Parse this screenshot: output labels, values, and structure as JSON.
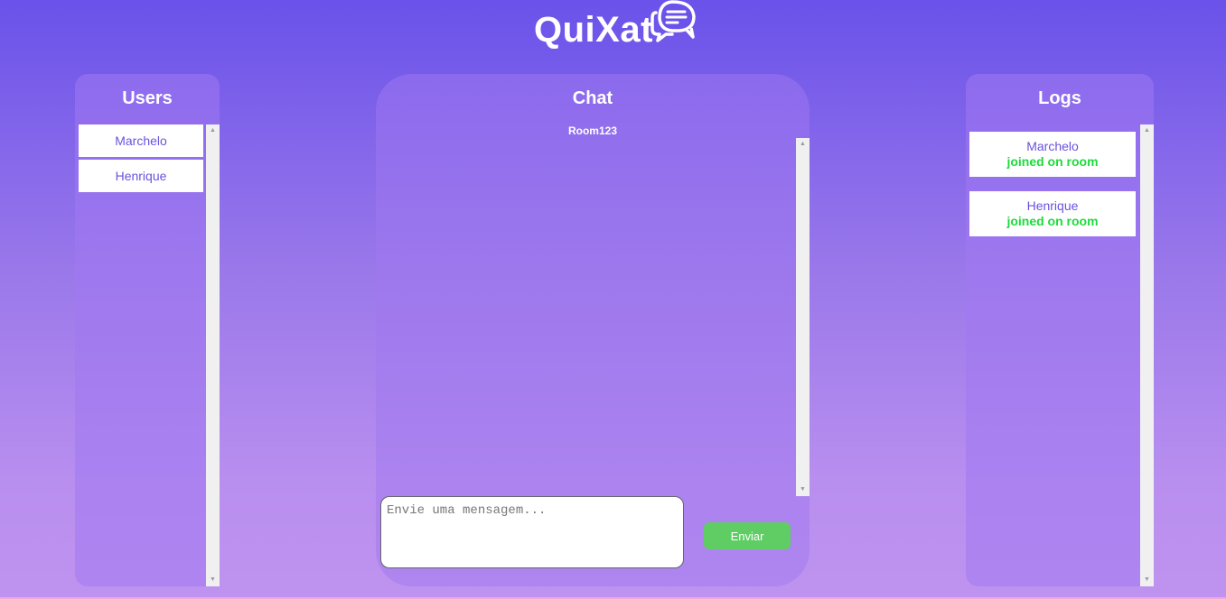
{
  "app": {
    "title": "QuiXat",
    "icon": "chat-bubbles-icon"
  },
  "users": {
    "title": "Users",
    "items": [
      {
        "name": "Marchelo"
      },
      {
        "name": "Henrique"
      }
    ]
  },
  "chat": {
    "title": "Chat",
    "room": "Room123",
    "input": {
      "value": "",
      "placeholder": "Envie uma mensagem..."
    },
    "send_label": "Enviar"
  },
  "logs": {
    "title": "Logs",
    "items": [
      {
        "user": "Marchelo",
        "action": "joined on room"
      },
      {
        "user": "Henrique",
        "action": "joined on room"
      }
    ]
  },
  "colors": {
    "accent": "#6a52e0",
    "success": "#1ddb3a",
    "send_button": "#5fcd64"
  }
}
